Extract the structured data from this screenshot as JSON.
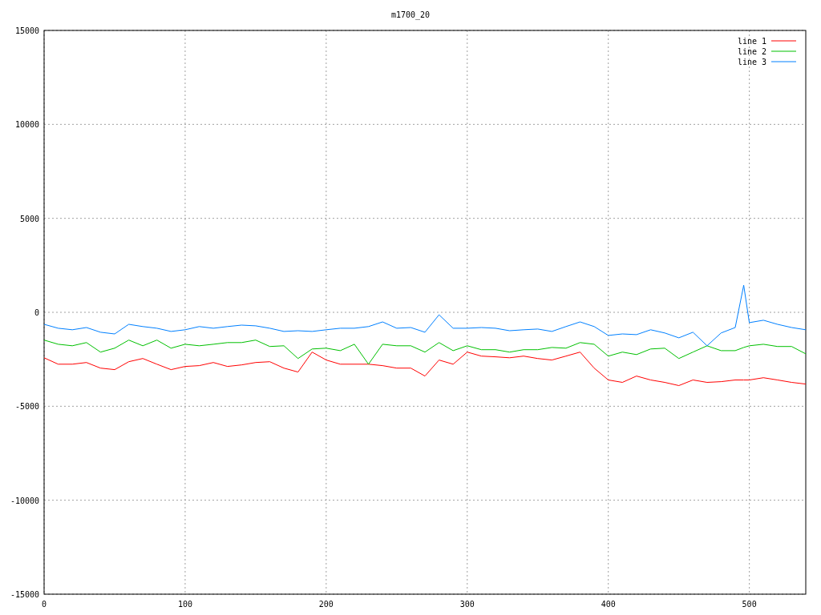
{
  "chart_data": {
    "type": "line",
    "title": "m1700_20",
    "x": [
      0,
      10,
      20,
      30,
      40,
      50,
      60,
      70,
      80,
      90,
      100,
      110,
      120,
      130,
      140,
      150,
      160,
      170,
      180,
      190,
      200,
      210,
      220,
      230,
      240,
      250,
      260,
      270,
      280,
      290,
      300,
      310,
      320,
      330,
      340,
      350,
      360,
      370,
      380,
      390,
      400,
      410,
      420,
      430,
      440,
      450,
      460,
      470,
      480,
      490,
      496,
      500,
      510,
      520,
      530,
      540
    ],
    "series": [
      {
        "name": "line 1",
        "color": "#ff0000",
        "values": [
          -2420,
          -2760,
          -2760,
          -2670,
          -2970,
          -3050,
          -2630,
          -2460,
          -2760,
          -3050,
          -2880,
          -2840,
          -2670,
          -2880,
          -2800,
          -2670,
          -2630,
          -2970,
          -3180,
          -2120,
          -2540,
          -2760,
          -2760,
          -2760,
          -2840,
          -2970,
          -2970,
          -3390,
          -2540,
          -2760,
          -2120,
          -2330,
          -2370,
          -2420,
          -2330,
          -2460,
          -2540,
          -2330,
          -2120,
          -2970,
          -3600,
          -3730,
          -3390,
          -3600,
          -3730,
          -3900,
          -3600,
          -3730,
          -3690,
          -3600,
          -3600,
          -3600,
          -3480,
          -3600,
          -3730,
          -3820
        ]
      },
      {
        "name": "line 2",
        "color": "#00c000",
        "values": [
          -1480,
          -1700,
          -1780,
          -1610,
          -2120,
          -1910,
          -1480,
          -1780,
          -1480,
          -1910,
          -1700,
          -1780,
          -1700,
          -1610,
          -1610,
          -1480,
          -1820,
          -1780,
          -2460,
          -1950,
          -1910,
          -2040,
          -1700,
          -2760,
          -1700,
          -1780,
          -1780,
          -2120,
          -1610,
          -2040,
          -1780,
          -1990,
          -1990,
          -2120,
          -1990,
          -1990,
          -1870,
          -1910,
          -1610,
          -1700,
          -2330,
          -2120,
          -2250,
          -1950,
          -1910,
          -2460,
          -2120,
          -1780,
          -2040,
          -2040,
          -1870,
          -1780,
          -1700,
          -1820,
          -1820,
          -2210
        ]
      },
      {
        "name": "line 3",
        "color": "#0080ff",
        "values": [
          -640,
          -850,
          -930,
          -810,
          -1060,
          -1150,
          -640,
          -760,
          -850,
          -1020,
          -930,
          -760,
          -850,
          -760,
          -680,
          -720,
          -850,
          -1020,
          -980,
          -1020,
          -930,
          -850,
          -850,
          -760,
          -510,
          -850,
          -810,
          -1060,
          -130,
          -850,
          -850,
          -810,
          -850,
          -980,
          -930,
          -890,
          -1020,
          -760,
          -510,
          -760,
          -1230,
          -1150,
          -1190,
          -930,
          -1100,
          -1360,
          -1060,
          -1780,
          -1100,
          -810,
          1440,
          -550,
          -420,
          -640,
          -810,
          -930
        ]
      }
    ],
    "grid": true,
    "legend": true,
    "xlim": [
      0,
      540
    ],
    "ylim": [
      -15000,
      15000
    ],
    "xticks": [
      0,
      100,
      200,
      300,
      400,
      500
    ],
    "yticks": [
      -15000,
      -10000,
      -5000,
      0,
      5000,
      10000,
      15000
    ]
  }
}
